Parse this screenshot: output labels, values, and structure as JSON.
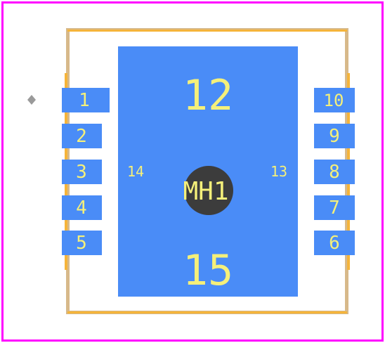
{
  "footprint": {
    "pads": [
      {
        "id": "1",
        "label": "1"
      },
      {
        "id": "2",
        "label": "2"
      },
      {
        "id": "3",
        "label": "3"
      },
      {
        "id": "4",
        "label": "4"
      },
      {
        "id": "5",
        "label": "5"
      },
      {
        "id": "6",
        "label": "6"
      },
      {
        "id": "7",
        "label": "7"
      },
      {
        "id": "8",
        "label": "8"
      },
      {
        "id": "9",
        "label": "9"
      },
      {
        "id": "10",
        "label": "10"
      },
      {
        "id": "12",
        "label": "12"
      },
      {
        "id": "13",
        "label": "13"
      },
      {
        "id": "14",
        "label": "14"
      },
      {
        "id": "15",
        "label": "15"
      }
    ],
    "mounting_hole": {
      "label": "MH1"
    },
    "colors": {
      "courtyard": "#ff00ff",
      "silkscreen": "#f5b43a",
      "fab_outline": "#d7b98a",
      "pad": "#4a8cf7",
      "hole": "#3c3c3c",
      "label_text": "#f5f07a"
    }
  }
}
